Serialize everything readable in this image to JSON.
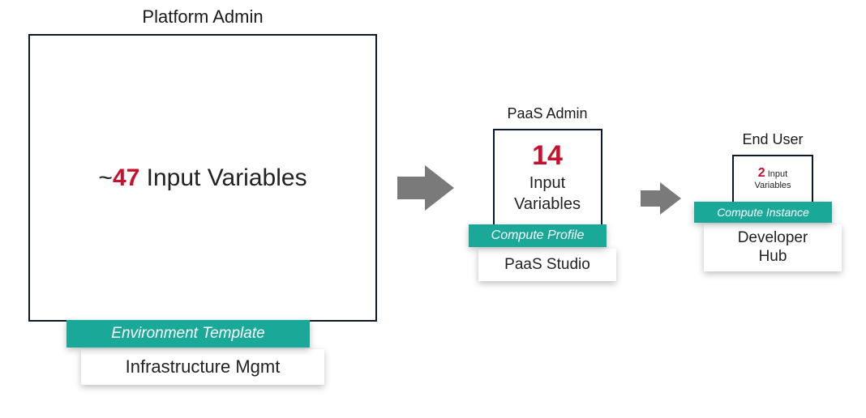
{
  "col1": {
    "title": "Platform Admin",
    "prefix": "~",
    "number": "47",
    "suffix": " Input Variables",
    "teal": "Environment Template",
    "bottom": "Infrastructure Mgmt"
  },
  "col2": {
    "title": "PaaS Admin",
    "number": "14",
    "line1": "Input",
    "line2": "Variables",
    "teal": "Compute Profile",
    "bottom": "PaaS Studio"
  },
  "col3": {
    "title": "End User",
    "number": "2",
    "line1": " Input",
    "line2": "Variables",
    "teal": "Compute Instance",
    "bottom1": "Developer",
    "bottom2": "Hub"
  }
}
